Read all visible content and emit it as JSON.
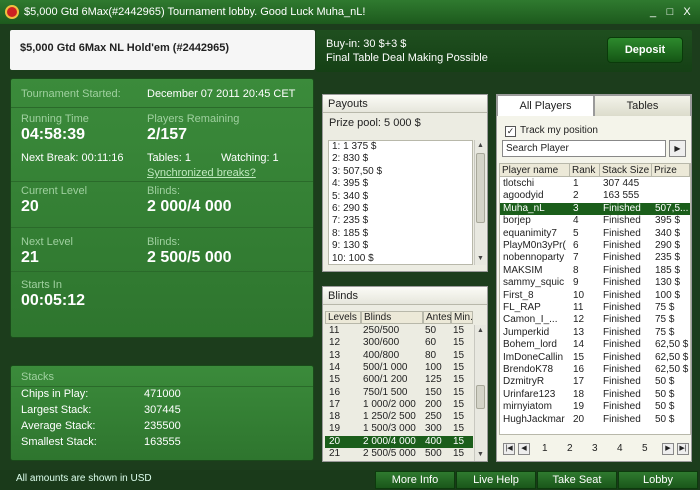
{
  "window": {
    "title": "$5,000 Gtd 6Max(#2442965) Tournament lobby. Good Luck Muha_nL!",
    "minimize": "_",
    "maximize": "□",
    "close": "X"
  },
  "header": {
    "tournament_name": "$5,000 Gtd 6Max NL Hold'em (#2442965)",
    "buyin": "Buy-in: 30 $+3 $",
    "final_table": "Final Table Deal Making Possible",
    "deposit_label": "Deposit"
  },
  "info": {
    "started_label": "Tournament Started:",
    "started_value": "December 07 2011   20:45 CET",
    "running_label": "Running Time",
    "running_value": "04:58:39",
    "players_label": "Players Remaining",
    "players_value": "2/157",
    "next_break": "Next Break: 00:11:16",
    "tables": "Tables: 1",
    "watching": "Watching: 1",
    "sync_link": "Synchronized breaks?",
    "current_level_label": "Current Level",
    "current_level_value": "20",
    "blinds_label": "Blinds:",
    "current_blinds": "2 000/4 000",
    "next_level_label": "Next Level",
    "next_level_value": "21",
    "next_blinds": "2 500/5 000",
    "starts_in_label": "Starts In",
    "starts_in_value": "00:05:12"
  },
  "stacks": {
    "title": "Stacks",
    "chips_label": "Chips in Play:",
    "chips_value": "471000",
    "largest_label": "Largest Stack:",
    "largest_value": "307445",
    "average_label": "Average Stack:",
    "average_value": "235500",
    "smallest_label": "Smallest Stack:",
    "smallest_value": "163555"
  },
  "footer_note": "All amounts are shown in USD",
  "payouts": {
    "title": "Payouts",
    "prize_pool": "Prize pool: 5 000 $",
    "items": [
      "1: 1 375 $",
      "2: 830 $",
      "3: 507,50 $",
      "4: 395 $",
      "5: 340 $",
      "6: 290 $",
      "7: 235 $",
      "8: 185 $",
      "9: 130 $",
      "10: 100 $"
    ]
  },
  "blinds": {
    "title": "Blinds",
    "headers": [
      "Levels",
      "Blinds",
      "Antes",
      "Min."
    ],
    "rows": [
      [
        "11",
        "250/500",
        "50",
        "15"
      ],
      [
        "12",
        "300/600",
        "60",
        "15"
      ],
      [
        "13",
        "400/800",
        "80",
        "15"
      ],
      [
        "14",
        "500/1 000",
        "100",
        "15"
      ],
      [
        "15",
        "600/1 200",
        "125",
        "15"
      ],
      [
        "16",
        "750/1 500",
        "150",
        "15"
      ],
      [
        "17",
        "1 000/2 000",
        "200",
        "15"
      ],
      [
        "18",
        "1 250/2 500",
        "250",
        "15"
      ],
      [
        "19",
        "1 500/3 000",
        "300",
        "15"
      ],
      [
        "20",
        "2 000/4 000",
        "400",
        "15"
      ],
      [
        "21",
        "2 500/5 000",
        "500",
        "15"
      ]
    ],
    "selected_index": 9
  },
  "players": {
    "tab_all": "All Players",
    "tab_tables": "Tables",
    "track_label": "Track my position",
    "search_value": "Search Player",
    "headers": [
      "Player name",
      "Rank",
      "Stack Size",
      "Prize"
    ],
    "rows": [
      [
        "tlotschi",
        "1",
        "307 445",
        ""
      ],
      [
        "agoodyid",
        "2",
        "163 555",
        ""
      ],
      [
        "Muha_nL",
        "3",
        "Finished",
        "507,5..."
      ],
      [
        "borjep",
        "4",
        "Finished",
        "395 $"
      ],
      [
        "equanimity7",
        "5",
        "Finished",
        "340 $"
      ],
      [
        "PlayM0n3yPr(",
        "6",
        "Finished",
        "290 $"
      ],
      [
        "nobennoparty",
        "7",
        "Finished",
        "235 $"
      ],
      [
        "MAKSIM",
        "8",
        "Finished",
        "185 $"
      ],
      [
        "sammy_squic",
        "9",
        "Finished",
        "130 $"
      ],
      [
        "First_8",
        "10",
        "Finished",
        "100 $"
      ],
      [
        "FL_RAP",
        "11",
        "Finished",
        "75 $"
      ],
      [
        "Camon_I_...",
        "12",
        "Finished",
        "75 $"
      ],
      [
        "Jumperkid",
        "13",
        "Finished",
        "75 $"
      ],
      [
        "Bohem_lord",
        "14",
        "Finished",
        "62,50 $"
      ],
      [
        "ImDoneCallin",
        "15",
        "Finished",
        "62,50 $"
      ],
      [
        "BrendoK78",
        "16",
        "Finished",
        "62,50 $"
      ],
      [
        "DzmitryR",
        "17",
        "Finished",
        "50 $"
      ],
      [
        "Urinfare123",
        "18",
        "Finished",
        "50 $"
      ],
      [
        "mirnyiatom",
        "19",
        "Finished",
        "50 $"
      ],
      [
        "HughJackmar",
        "20",
        "Finished",
        "50 $"
      ]
    ],
    "selected_index": 2,
    "pages": [
      "1",
      "2",
      "3",
      "4",
      "5"
    ]
  },
  "bottom_buttons": {
    "more_info": "More Info",
    "live_help": "Live Help",
    "take_seat": "Take Seat",
    "lobby": "Lobby"
  }
}
